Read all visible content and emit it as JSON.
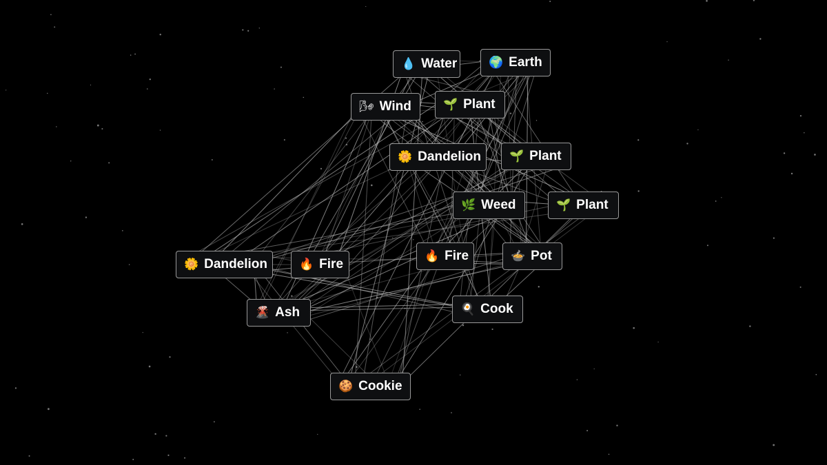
{
  "tiles": [
    {
      "label": "Water",
      "icon": "water-drop-icon",
      "emoji": "💧"
    },
    {
      "label": "Earth",
      "icon": "globe-icon",
      "emoji": "🌍"
    },
    {
      "label": "Wind",
      "icon": "wind-icon",
      "emoji": "🌬"
    },
    {
      "label": "Plant",
      "icon": "seedling-icon",
      "emoji": "🌱"
    },
    {
      "label": "Dandelion",
      "icon": "flower-icon",
      "emoji": "🌼"
    },
    {
      "label": "Plant",
      "icon": "seedling-icon",
      "emoji": "🌱"
    },
    {
      "label": "Weed",
      "icon": "herb-icon",
      "emoji": "🌿"
    },
    {
      "label": "Plant",
      "icon": "seedling-icon",
      "emoji": "🌱"
    },
    {
      "label": "Dandelion",
      "icon": "flower-icon",
      "emoji": "🌼"
    },
    {
      "label": "Fire",
      "icon": "fire-icon",
      "emoji": "🔥"
    },
    {
      "label": "Fire",
      "icon": "fire-icon",
      "emoji": "🔥"
    },
    {
      "label": "Pot",
      "icon": "pot-icon",
      "emoji": "🍲"
    },
    {
      "label": "Ash",
      "icon": "volcano-icon",
      "emoji": "🌋"
    },
    {
      "label": "Cook",
      "icon": "frying-pan-icon",
      "emoji": "🍳"
    },
    {
      "label": "Cookie",
      "icon": "cookie-icon",
      "emoji": "🍪"
    }
  ]
}
